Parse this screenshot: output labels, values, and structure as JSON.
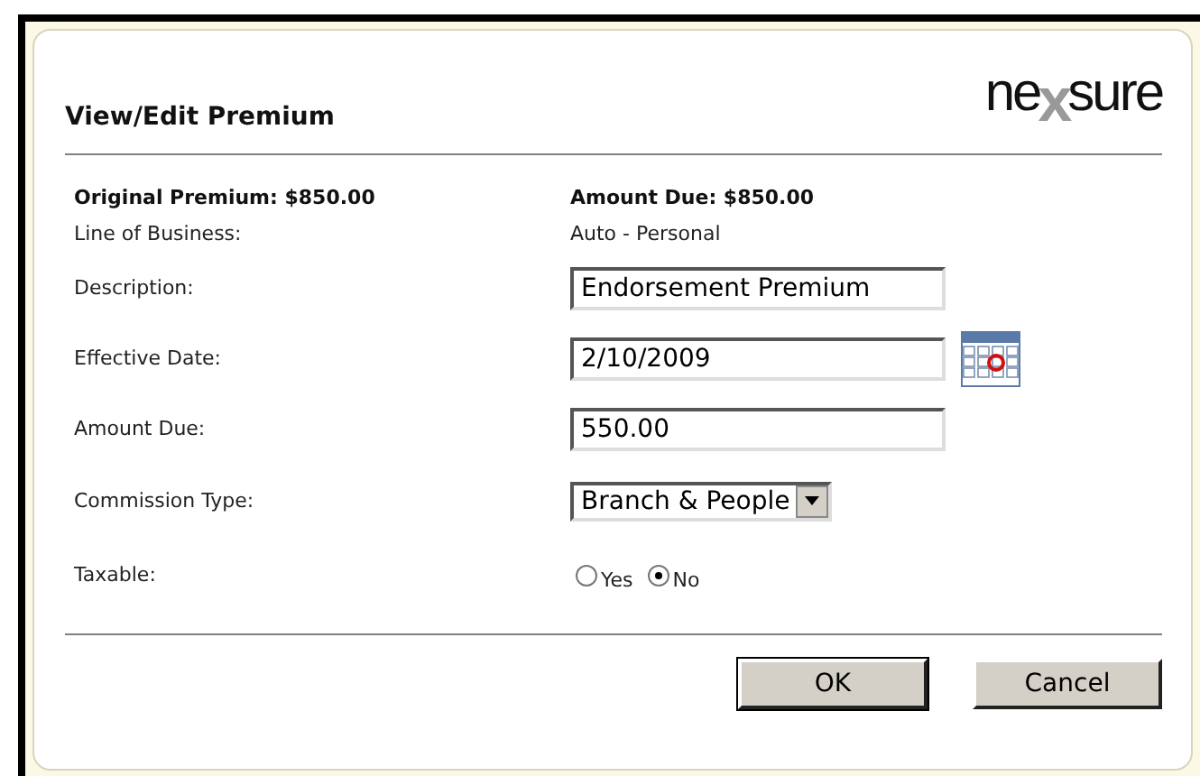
{
  "dialog": {
    "title": "View/Edit Premium",
    "logo": {
      "before": "ne",
      "mark": "x",
      "after": "sure"
    }
  },
  "summary": [
    {
      "label": "Original Premium: $850.00"
    },
    {
      "label": "Amount Due: $850.00"
    }
  ],
  "fields": [
    {
      "kind": "text",
      "label": "Line of Business:",
      "value": "Auto - Personal"
    },
    {
      "kind": "input",
      "label": "Description:",
      "value": "Endorsement Premium"
    },
    {
      "kind": "date",
      "label": "Effective Date:",
      "value": "2/10/2009"
    },
    {
      "kind": "input",
      "label": "Amount Due:",
      "value": "550.00"
    },
    {
      "kind": "select",
      "label": "Commission Type:",
      "value": "Branch & People"
    },
    {
      "kind": "radio",
      "label": "Taxable:",
      "options": [
        {
          "label": "Yes",
          "selected": false
        },
        {
          "label": "No",
          "selected": true
        }
      ]
    }
  ],
  "buttons": [
    "OK",
    "Cancel"
  ]
}
